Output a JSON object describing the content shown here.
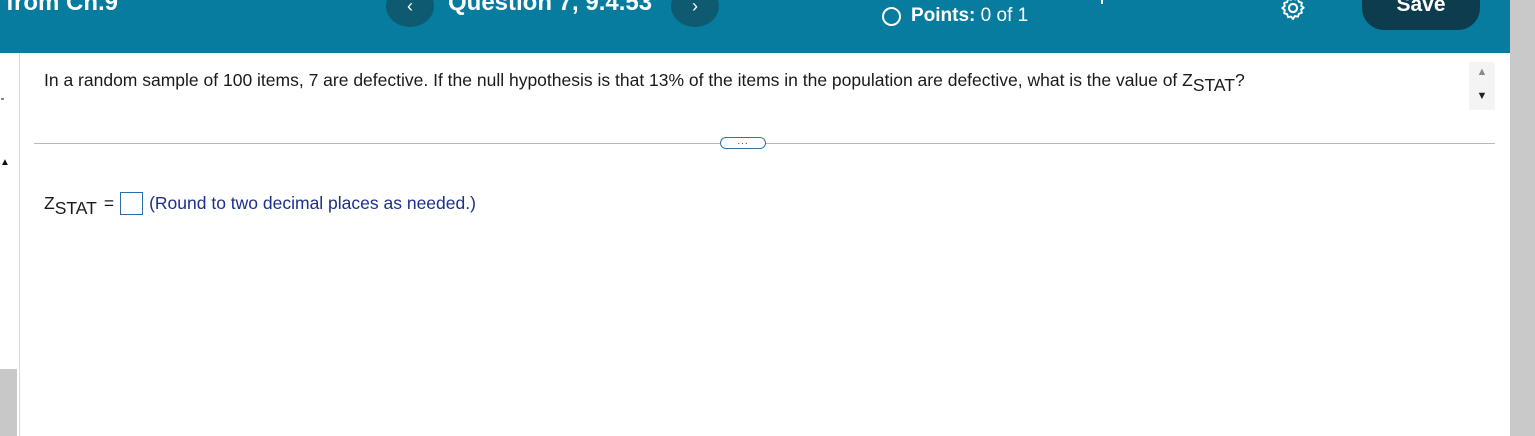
{
  "header": {
    "title": "from Ch.9",
    "prev_icon": "‹",
    "next_icon": "›",
    "question_title": "Question 7, 9.4.53",
    "points_label": "Points:",
    "points_value": "0 of 1",
    "save_label": "Save",
    "accent_color": "#077c9e"
  },
  "question": {
    "text": "In a random sample of 100 items, 7 are defective. If the null hypothesis is that 13% of the items in the population are defective, what is the value of Z",
    "subscript": "STAT",
    "end": "?"
  },
  "more_button": "...",
  "answer": {
    "var": "Z",
    "subscript": "STAT",
    "equals": "=",
    "value": "",
    "hint": "(Round to two decimal places as needed.)"
  }
}
